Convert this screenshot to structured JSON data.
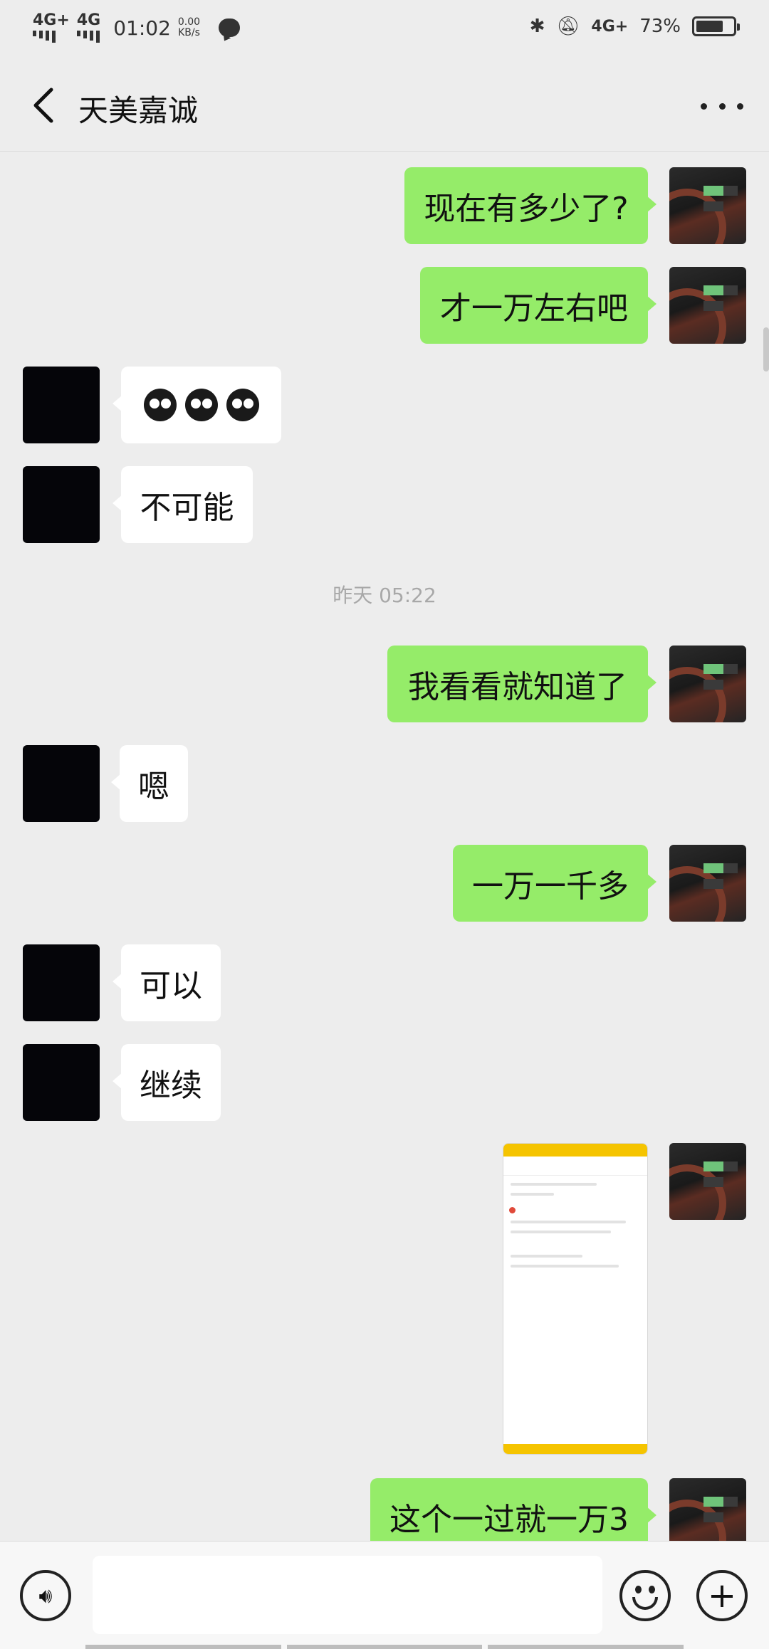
{
  "status_bar": {
    "network_1": "4G+",
    "network_2": "4G",
    "time": "01:02",
    "speed_value": "0.00",
    "speed_unit": "KB/s",
    "right_network": "4G+",
    "battery_percent": "73%",
    "battery_level": 0.73
  },
  "header": {
    "title": "天美嘉诚"
  },
  "messages": [
    {
      "side": "out",
      "text": "现在有多少了?"
    },
    {
      "side": "out",
      "text": "才一万左右吧"
    },
    {
      "side": "in",
      "type": "emoji",
      "emoji_count": 3
    },
    {
      "side": "in",
      "text": "不可能"
    },
    {
      "side": "out",
      "text": "我看看就知道了"
    },
    {
      "side": "in",
      "text": "嗯"
    },
    {
      "side": "out",
      "text": "一万一千多"
    },
    {
      "side": "in",
      "text": "可以"
    },
    {
      "side": "in",
      "text": "继续"
    },
    {
      "side": "out",
      "type": "image"
    },
    {
      "side": "out",
      "text": "这个一过就一万3"
    }
  ],
  "timestamp": "昨天 05:22",
  "colors": {
    "outgoing_bubble": "#95ec69",
    "incoming_bubble": "#ffffff",
    "background": "#ededed"
  }
}
